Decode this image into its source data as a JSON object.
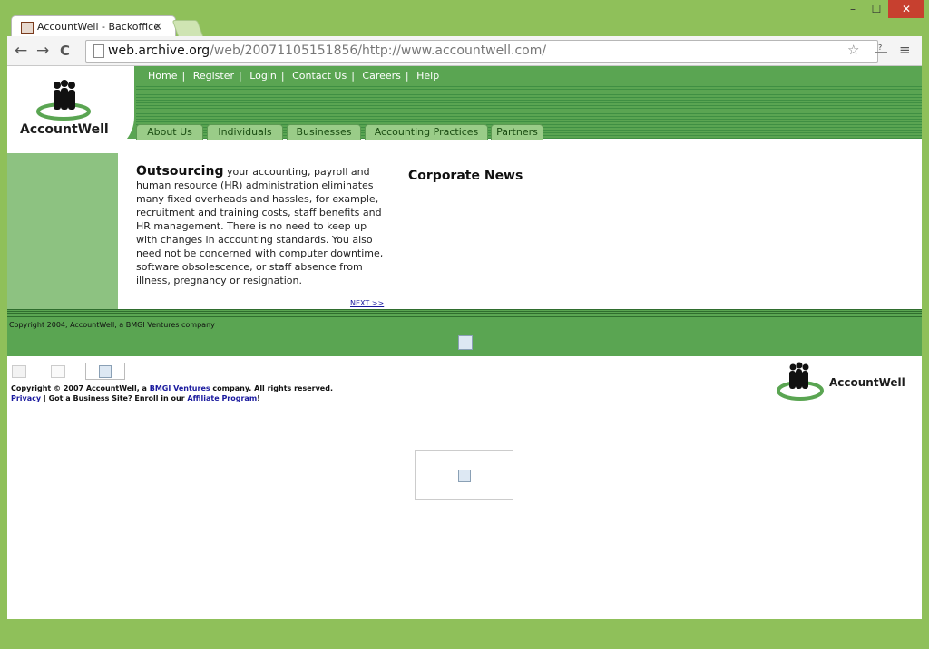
{
  "browser": {
    "tab_title": "AccountWell - Backoffice",
    "tab_close": "×",
    "url_host": "web.archive.org",
    "url_path": "/web/20071105151856/http://www.accountwell.com/",
    "window_controls": {
      "minimize": "–",
      "maximize": "☐",
      "close": "✕"
    },
    "icons": {
      "back": "←",
      "forward": "→",
      "reload": "C",
      "star": "☆",
      "menu": "≡"
    }
  },
  "site": {
    "logo_text": "AccountWell",
    "top_nav": [
      "Home",
      "Register",
      "Login",
      "Contact Us",
      "Careers",
      "Help"
    ],
    "nav_separator": "|",
    "tabs": [
      "About Us",
      "Individuals",
      "Businesses",
      "Accounting Practices",
      "Partners"
    ],
    "intro_heading": "Outsourcing",
    "intro_text": "your accounting, payroll and human resource (HR) administration eliminates many fixed overheads and hassles, for example, recruitment and training costs, staff benefits and HR management. There is no need to keep up with changes in accounting standards. You also need not be concerned with computer downtime, software obsolescence, or staff absence from illness, pregnancy or resignation.",
    "next_link": "NEXT >>",
    "news_heading": "Corporate News",
    "copyright_band": "Copyright 2004, AccountWell, a BMGI Ventures company"
  },
  "footer": {
    "copyright_prefix": "Copyright © 2007 AccountWell, a ",
    "bmgi_link": "BMGI Ventures",
    "copyright_suffix": " company. All rights reserved.",
    "privacy_link": "Privacy",
    "middle_text": " | Got a Business Site?  Enroll in our ",
    "affiliate_link": "Affiliate Program",
    "end_text": "!",
    "logo_text": "AccountWell"
  },
  "colors": {
    "green_band": "#5aa552",
    "light_green": "#8dc281",
    "frame": "#8fc05a",
    "close_button": "#c7402f"
  }
}
